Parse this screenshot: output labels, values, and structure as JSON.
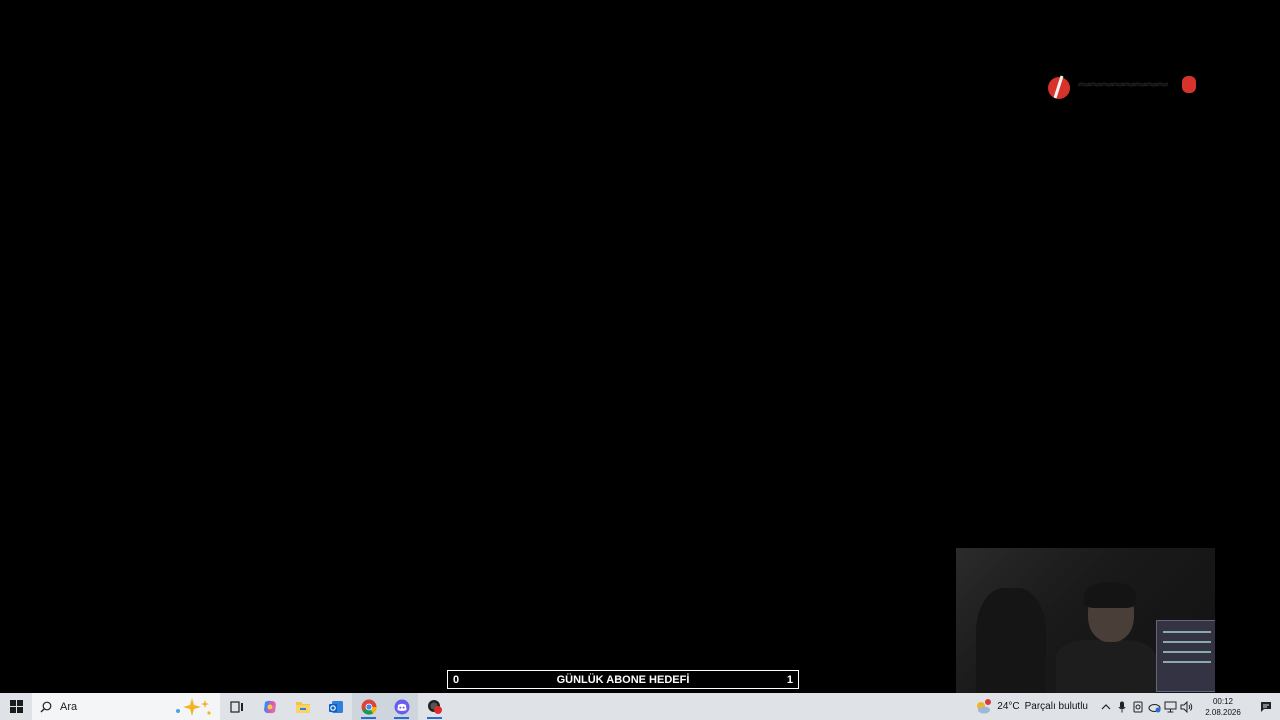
{
  "overlay": {
    "goal": {
      "left_value": "0",
      "title": "GÜNLÜK ABONE HEDEFİ",
      "right_value": "1"
    },
    "logo_accent_color": "#d8332b"
  },
  "taskbar": {
    "search_placeholder": "Ara",
    "apps": [
      {
        "icon": "task-view-icon"
      },
      {
        "icon": "copilot-icon"
      },
      {
        "icon": "file-explorer-icon"
      },
      {
        "icon": "outlook-icon"
      },
      {
        "icon": "chrome-icon",
        "open": true
      },
      {
        "icon": "discord-icon",
        "open": true
      },
      {
        "icon": "red-app-icon",
        "open": true
      }
    ],
    "weather": {
      "temperature": "24°C",
      "condition": "Parçalı bulutlu"
    },
    "clock": {
      "time": "00:12",
      "date": "2.08.2026"
    }
  },
  "colors": {
    "taskbar_bg": "#dfe3e8",
    "active_indicator": "#2b6cd4"
  }
}
